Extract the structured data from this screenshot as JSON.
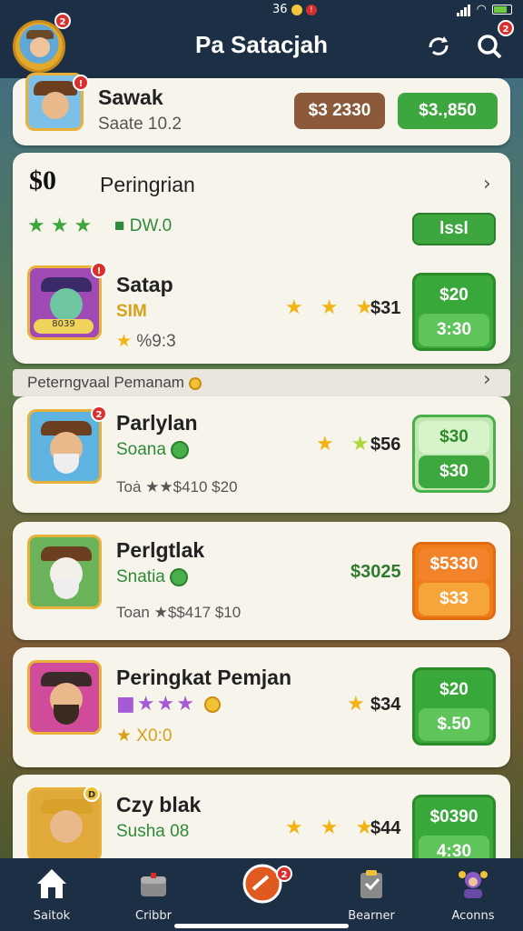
{
  "status_bar": {
    "center_text": "36",
    "badge": "!"
  },
  "header": {
    "title": "Pa Satacjah",
    "avatar_badge": "2",
    "search_badge": "2"
  },
  "cards": [
    {
      "name": "Sawak",
      "sub": "Saate 10.2",
      "btn_brown": "$3 2330",
      "btn_green": "$3.,850"
    },
    {
      "name": "Peringrian",
      "logo": "$0",
      "rating_text": "DW.0",
      "btn": "lssl",
      "row2_name": "Satap",
      "row2_sub": "SIM",
      "row2_sub2": "%9:3",
      "thumb_text": "8039",
      "price": "$31",
      "btn_top": "$20",
      "btn_bot": "3:30"
    }
  ],
  "section_title": "Peterngvaal Pemanam",
  "games": [
    {
      "name": "Parlylan",
      "sub": "Soana",
      "meta": "Toȧ ★★$410 $20",
      "price": "$56",
      "btn_top": "$30",
      "btn_bot": "$30",
      "badge": "2",
      "style": "light"
    },
    {
      "name": "Perlgtlak",
      "sub": "Snatia",
      "meta": "Toan ★$$417 $10",
      "price": "$3025",
      "btn_top": "$5330",
      "btn_bot": "$33",
      "style": "orange"
    },
    {
      "name": "Peringkat Pemjan",
      "sub": "★ X0:0",
      "price": "$34",
      "btn_top": "$20",
      "btn_bot": "$.50",
      "style": "green"
    },
    {
      "name": "Czy blak",
      "sub": "Susha 08",
      "price": "$44",
      "btn_top": "$0390",
      "btn_bot": "4:30",
      "badge": "D",
      "style": "green"
    }
  ],
  "nav": [
    "Saitok",
    "Cribbr",
    "Bearner",
    "Aconns"
  ],
  "nav_badge": "2"
}
